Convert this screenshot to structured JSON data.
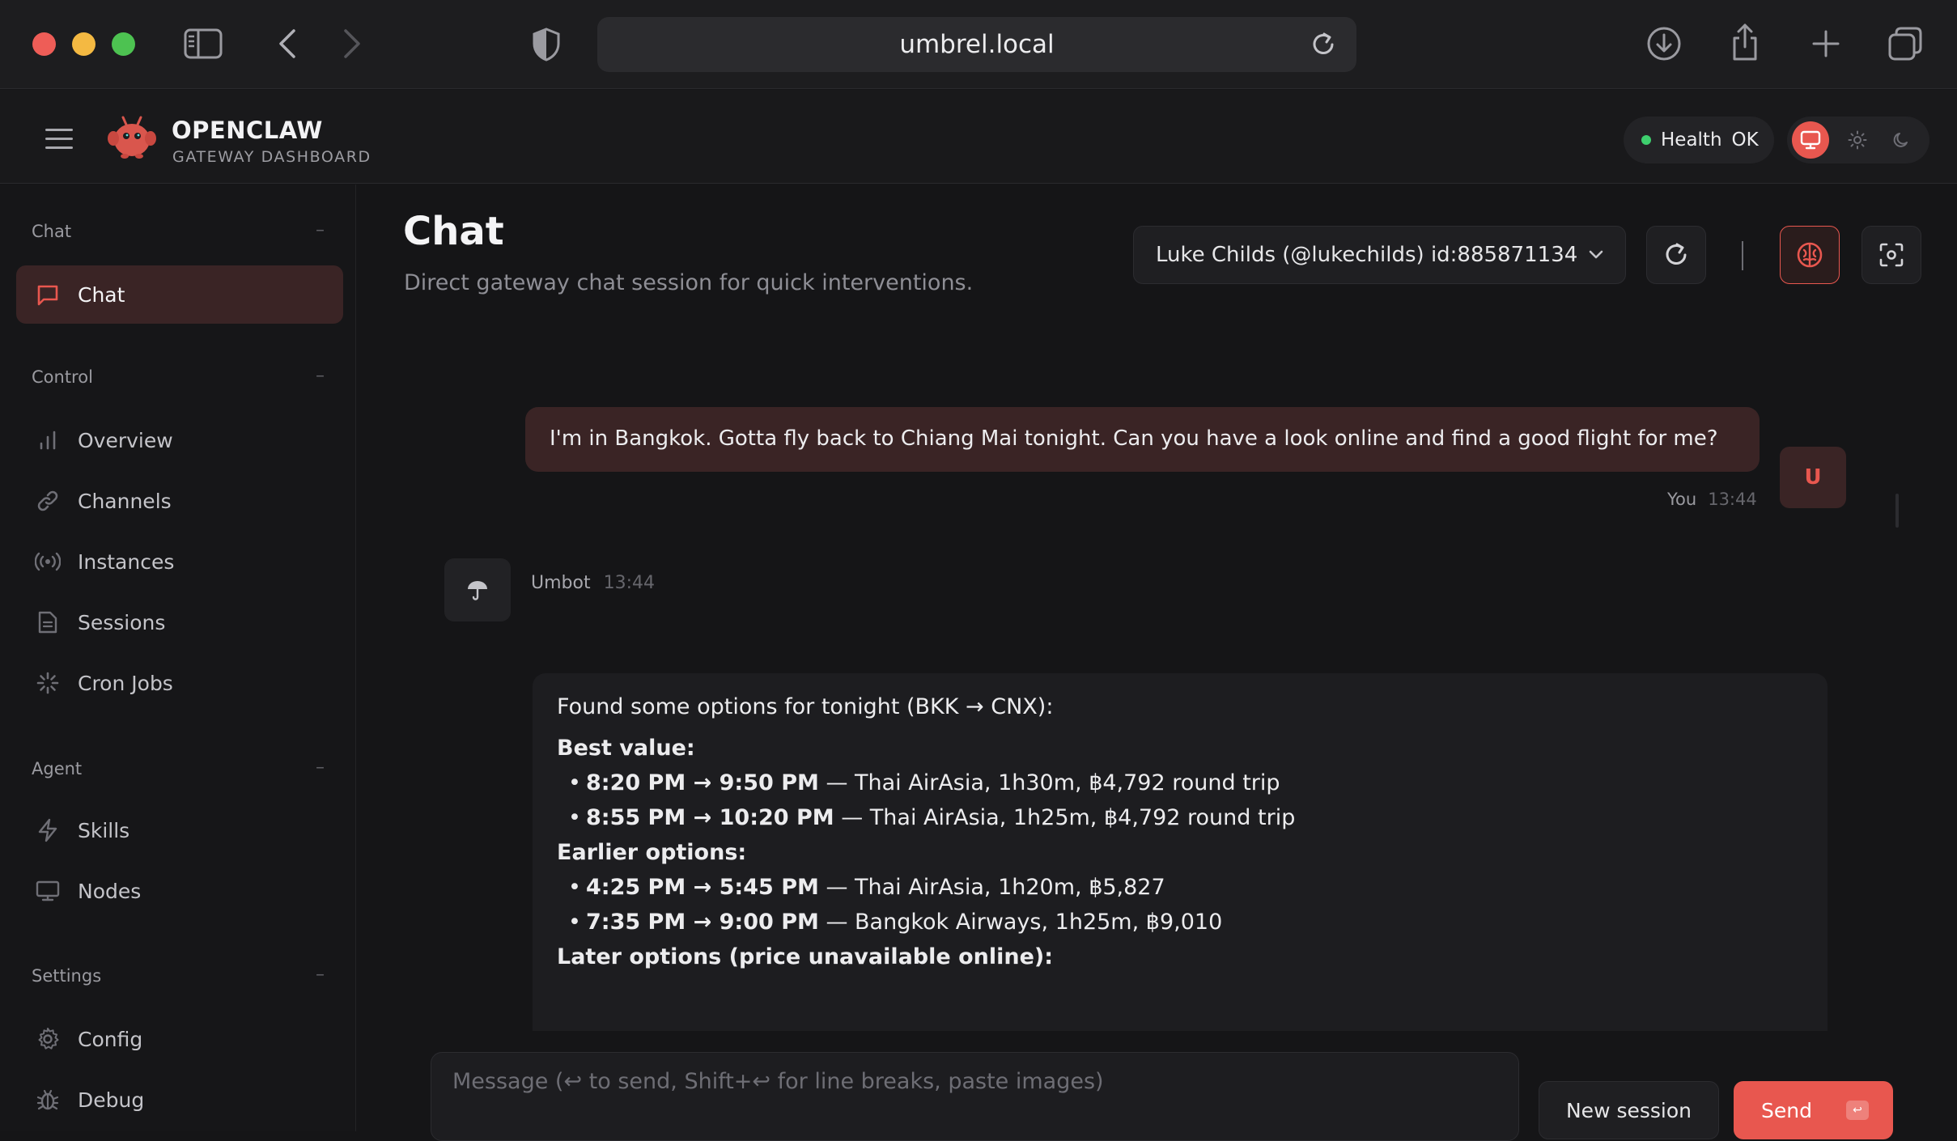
{
  "browser": {
    "url": "umbrel.local"
  },
  "app": {
    "brand_title": "OPENCLAW",
    "brand_subtitle": "GATEWAY DASHBOARD",
    "health_label": "Health",
    "health_value": "OK"
  },
  "sidebar": {
    "sections": [
      {
        "title": "Chat",
        "items": [
          {
            "label": "Chat",
            "icon": "message-square-icon",
            "active": true
          }
        ]
      },
      {
        "title": "Control",
        "items": [
          {
            "label": "Overview",
            "icon": "bar-chart-icon"
          },
          {
            "label": "Channels",
            "icon": "link-icon"
          },
          {
            "label": "Instances",
            "icon": "radio-icon"
          },
          {
            "label": "Sessions",
            "icon": "file-text-icon"
          },
          {
            "label": "Cron Jobs",
            "icon": "loader-icon"
          }
        ]
      },
      {
        "title": "Agent",
        "items": [
          {
            "label": "Skills",
            "icon": "zap-icon"
          },
          {
            "label": "Nodes",
            "icon": "monitor-icon"
          }
        ]
      },
      {
        "title": "Settings",
        "items": [
          {
            "label": "Config",
            "icon": "gear-icon"
          },
          {
            "label": "Debug",
            "icon": "bug-icon"
          }
        ]
      }
    ]
  },
  "main": {
    "title": "Chat",
    "subtitle": "Direct gateway chat session for quick interventions.",
    "session_select": "Luke Childs (@lukechilds) id:885871134"
  },
  "messages": {
    "user": {
      "text": "I'm in Bangkok. Gotta fly back to Chiang Mai tonight. Can you have a look online and find a good flight for me?",
      "sender": "You",
      "time": "13:44",
      "avatar": "U"
    },
    "bot": {
      "sender": "Umbot",
      "time": "13:44",
      "intro": "Found some options for tonight (BKK → CNX):",
      "best_heading": "Best value:",
      "best": [
        {
          "time": "8:20 PM → 9:50 PM",
          "detail": " — Thai AirAsia, 1h30m, ฿4,792 round trip"
        },
        {
          "time": "8:55 PM → 10:20 PM",
          "detail": " — Thai AirAsia, 1h25m, ฿4,792 round trip"
        }
      ],
      "earlier_heading": "Earlier options:",
      "earlier": [
        {
          "time": "4:25 PM → 5:45 PM",
          "detail": " — Thai AirAsia, 1h20m, ฿5,827"
        },
        {
          "time": "7:35 PM → 9:00 PM",
          "detail": " — Bangkok Airways, 1h25m, ฿9,010"
        }
      ],
      "later_heading": "Later options (price unavailable online):"
    }
  },
  "composer": {
    "placeholder": "Message (↩ to send, Shift+↩ for line breaks, paste images)",
    "new_session_label": "New session",
    "send_label": "Send",
    "send_kbd": "↩"
  },
  "colors": {
    "accent": "#e8574f",
    "health_ok": "#3ecf6e"
  }
}
